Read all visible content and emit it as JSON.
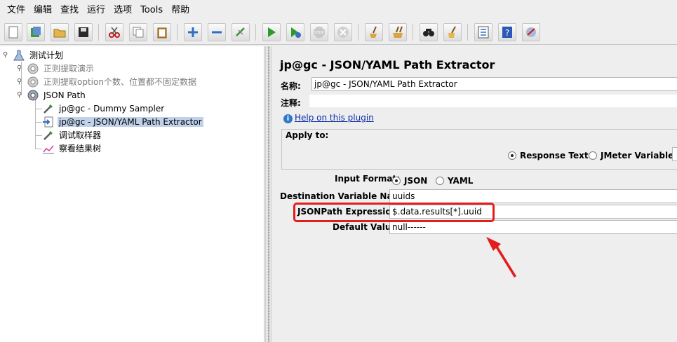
{
  "menubar": {
    "items": [
      "文件",
      "编辑",
      "查找",
      "运行",
      "选项",
      "Tools",
      "帮助"
    ]
  },
  "toolbar": {
    "buttons": [
      "new-icon",
      "templates-icon",
      "open-icon",
      "save-icon",
      "cut-icon",
      "copy-icon",
      "paste-icon",
      "expand-icon",
      "collapse-icon",
      "toggle-icon",
      "start-icon",
      "start-no-pauses-icon",
      "stop-icon",
      "shutdown-icon",
      "clear-icon",
      "clear-all-icon",
      "search-icon",
      "reset-search-icon",
      "function-helper-icon",
      "help-icon",
      "remote-icon"
    ]
  },
  "tree": {
    "root": "测试计划",
    "groups": [
      {
        "label": "正则提取演示",
        "enabled": false
      },
      {
        "label": "正则提取option个数、位置都不固定数据",
        "enabled": false
      },
      {
        "label": "JSON Path",
        "enabled": true
      }
    ],
    "children": [
      {
        "label": "jp@gc - Dummy Sampler",
        "icon": "sampler-icon"
      },
      {
        "label": "jp@gc - JSON/YAML Path Extractor",
        "icon": "extractor-icon",
        "selected": true
      },
      {
        "label": "调试取样器",
        "icon": "sampler-icon"
      },
      {
        "label": "察看结果树",
        "icon": "listener-icon"
      }
    ]
  },
  "panel": {
    "title": "jp@gc - JSON/YAML Path Extractor",
    "name_label": "名称:",
    "name_value": "jp@gc - JSON/YAML Path Extractor",
    "comment_label": "注释:",
    "comment_value": "",
    "help_link": "Help on this plugin",
    "apply_to_label": "Apply to:",
    "apply_options": [
      {
        "label": "Response Text",
        "selected": true
      },
      {
        "label": "JMeter Variable:",
        "selected": false
      }
    ],
    "input_format_label": "Input Format:",
    "input_formats": [
      {
        "label": "JSON",
        "selected": true
      },
      {
        "label": "YAML",
        "selected": false
      }
    ],
    "dest_var_label": "Destination Variable Name:",
    "dest_var_value": "uuids",
    "jsonpath_label": "JSONPath Expression:",
    "jsonpath_value": "$.data.results[*].uuid",
    "default_label": "Default Value:",
    "default_value": "null------"
  },
  "annotation": {
    "highlight_color": "#e51c1c"
  }
}
